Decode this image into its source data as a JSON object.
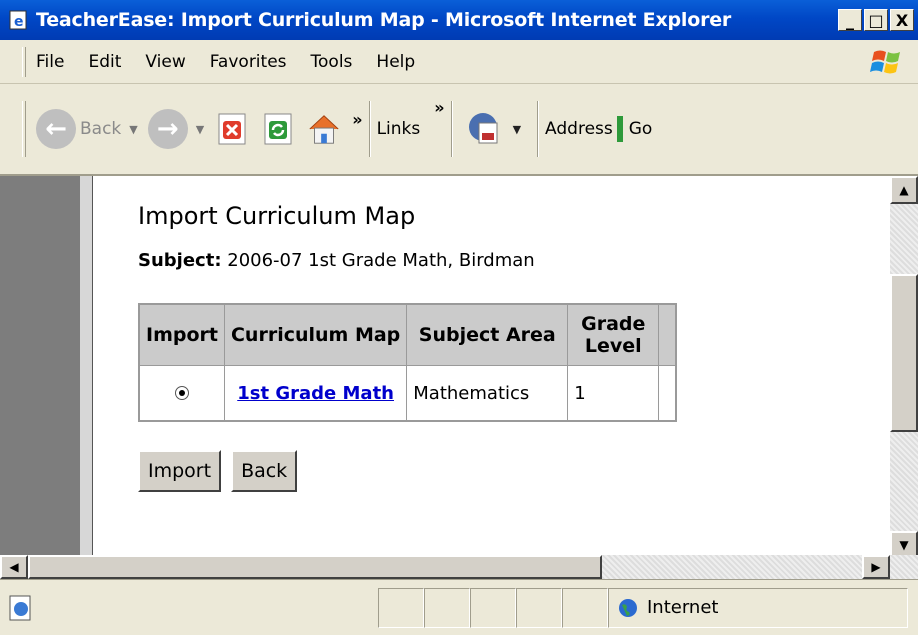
{
  "window": {
    "title": "TeacherEase: Import Curriculum Map - Microsoft Internet Explorer",
    "caption_buttons": [
      "_",
      "□",
      "X"
    ]
  },
  "menu": {
    "items": [
      "File",
      "Edit",
      "View",
      "Favorites",
      "Tools",
      "Help"
    ]
  },
  "toolbar": {
    "back_label": "Back",
    "links_label": "Links",
    "address_label": "Address",
    "go_label": "Go",
    "chevron": "»"
  },
  "page": {
    "title": "Import Curriculum Map",
    "subject_label": "Subject:",
    "subject_value": "2006-07 1st Grade Math, Birdman",
    "table": {
      "headers": [
        "Import",
        "Curriculum Map",
        "Subject Area",
        "Grade Level"
      ],
      "rows": [
        {
          "curriculum_map": "1st Grade Math",
          "subject_area": "Mathematics",
          "grade_level": "1",
          "selected": true
        }
      ]
    },
    "buttons": {
      "import": "Import",
      "back": "Back"
    }
  },
  "status": {
    "zone": "Internet"
  },
  "colors": {
    "titlebar": "#0047c6",
    "link": "#0000cc",
    "chrome": "#ece9d8",
    "table_header": "#cbcbcb"
  }
}
